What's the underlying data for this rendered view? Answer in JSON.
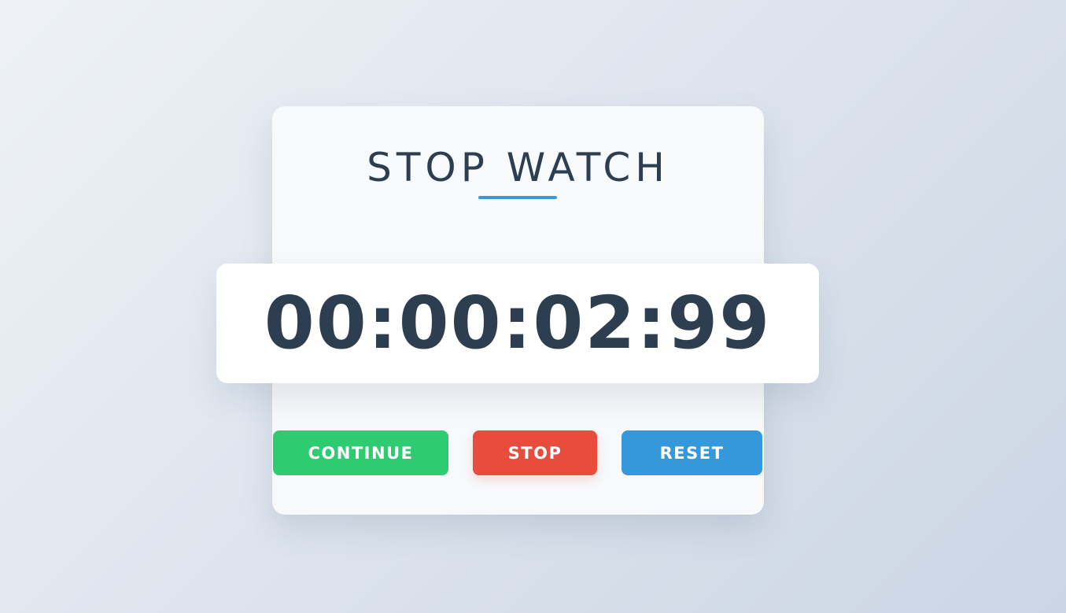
{
  "app": {
    "title": "STOP WATCH"
  },
  "display": {
    "time": "00:00:02:99"
  },
  "controls": {
    "continue_label": "CONTINUE",
    "stop_label": "STOP",
    "reset_label": "RESET"
  },
  "colors": {
    "accent": "#3498db",
    "text": "#2c3e50",
    "continue": "#2ecc71",
    "stop": "#e74c3c",
    "reset": "#3498db"
  }
}
